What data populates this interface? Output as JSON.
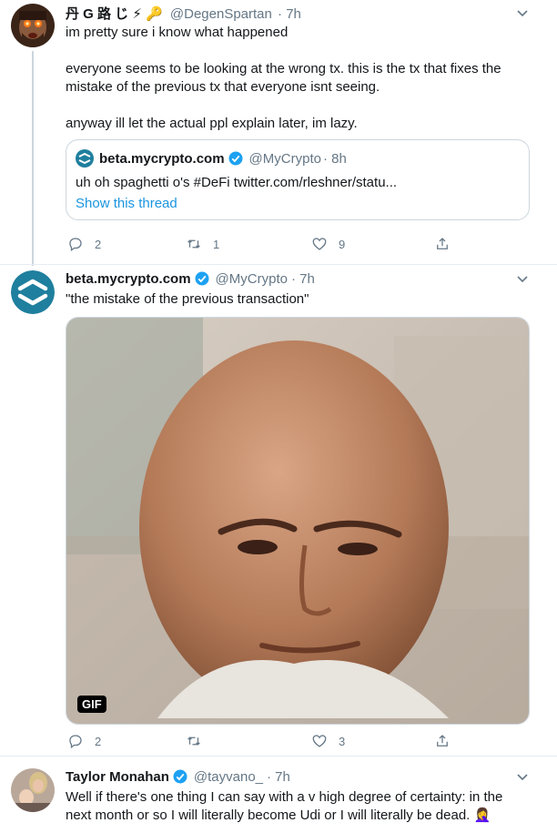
{
  "tweet1": {
    "name": "丹 G 路 じ ⚡ 🔑",
    "handle": "@DegenSpartan",
    "time": "· 7h",
    "text": "im pretty sure i know what happened\n\neveryone seems to be looking at the wrong tx. this is the tx that fixes the mistake of the previous tx that everyone isnt seeing.\n\nanyway ill let the actual ppl explain later, im lazy.",
    "quote": {
      "name": "beta.mycrypto.com",
      "handle": "@MyCrypto",
      "time": "· 8h",
      "text": "uh oh spaghetti o's #DeFi twitter.com/rleshner/statu...",
      "show_thread": "Show this thread"
    },
    "replies": "2",
    "retweets": "1",
    "likes": "9"
  },
  "tweet2": {
    "name": "beta.mycrypto.com",
    "handle": "@MyCrypto",
    "time": "· 7h",
    "text": "\"the mistake of the previous transaction\"",
    "media_badge": "GIF",
    "replies": "2",
    "retweets": "",
    "likes": "3"
  },
  "tweet3": {
    "name": "Taylor Monahan",
    "handle": "@tayvano_",
    "time": "· 7h",
    "text": "Well if there's one thing I can say with a v high degree of certainty: in the next month or so I will literally become Udi or I will literally be dead. 🤦‍♀️"
  },
  "colors": {
    "accent": "#1da1f2",
    "link": "#1b95e0",
    "muted": "#657786",
    "border": "#ccd6dd"
  },
  "icons": [
    "reply-icon",
    "retweet-icon",
    "like-icon",
    "share-icon",
    "verified-icon",
    "chevron-down-icon"
  ]
}
